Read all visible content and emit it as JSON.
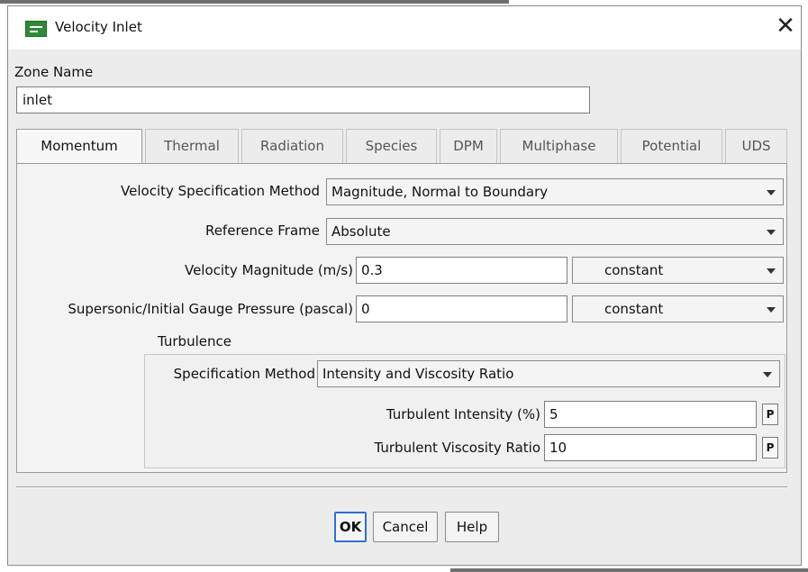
{
  "window": {
    "title": "Velocity Inlet",
    "close_glyph": "✕",
    "icon": "ansys-fluent-app-icon"
  },
  "zone": {
    "label": "Zone Name",
    "value": "inlet"
  },
  "tabs": [
    {
      "label": "Momentum",
      "active": true
    },
    {
      "label": "Thermal",
      "active": false
    },
    {
      "label": "Radiation",
      "active": false
    },
    {
      "label": "Species",
      "active": false
    },
    {
      "label": "DPM",
      "active": false
    },
    {
      "label": "Multiphase",
      "active": false
    },
    {
      "label": "Potential",
      "active": false
    },
    {
      "label": "UDS",
      "active": false
    }
  ],
  "momentum": {
    "velocity_spec_method": {
      "label": "Velocity Specification Method",
      "value": "Magnitude, Normal to Boundary"
    },
    "reference_frame": {
      "label": "Reference Frame",
      "value": "Absolute"
    },
    "velocity_magnitude": {
      "label": "Velocity Magnitude (m/s)",
      "value": "0.3",
      "profile": "constant"
    },
    "gauge_pressure": {
      "label": "Supersonic/Initial Gauge Pressure (pascal)",
      "value": "0",
      "profile": "constant"
    },
    "turbulence": {
      "heading": "Turbulence",
      "spec_method": {
        "label": "Specification Method",
        "value": "Intensity and Viscosity Ratio"
      },
      "intensity": {
        "label": "Turbulent Intensity (%)",
        "value": "5",
        "param_button": "P"
      },
      "viscosity_ratio": {
        "label": "Turbulent Viscosity Ratio",
        "value": "10",
        "param_button": "P"
      }
    }
  },
  "buttons": {
    "ok": "OK",
    "cancel": "Cancel",
    "help": "Help"
  }
}
